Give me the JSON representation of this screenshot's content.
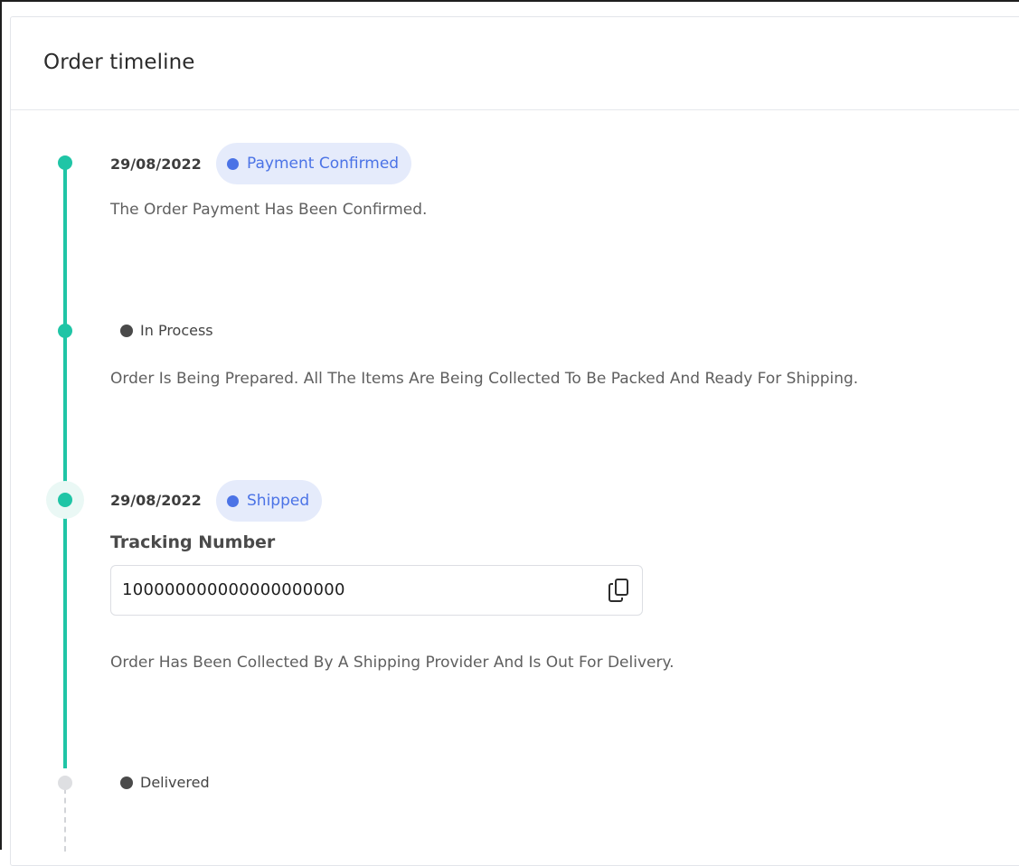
{
  "card": {
    "title": "Order timeline"
  },
  "timeline": [
    {
      "date": "29/08/2022",
      "status": "Payment Confirmed",
      "description": "The Order Payment Has Been Confirmed."
    },
    {
      "date": "",
      "status": "In Process",
      "description": "Order Is Being Prepared. All The Items Are Being Collected To Be Packed And Ready For Shipping."
    },
    {
      "date": "29/08/2022",
      "status": "Shipped",
      "tracking_label": "Tracking Number",
      "tracking_number": "100000000000000000000",
      "description": "Order Has Been Collected By A Shipping Provider And Is Out For Delivery."
    },
    {
      "date": "",
      "status": "Delivered",
      "description": ""
    }
  ],
  "icons": {
    "copy": "copy-icon"
  },
  "colors": {
    "accent": "#20c5a6",
    "badge_bg": "#e5ebfb",
    "badge_text": "#4b73e6",
    "inactive_dot": "#dedfe2"
  }
}
